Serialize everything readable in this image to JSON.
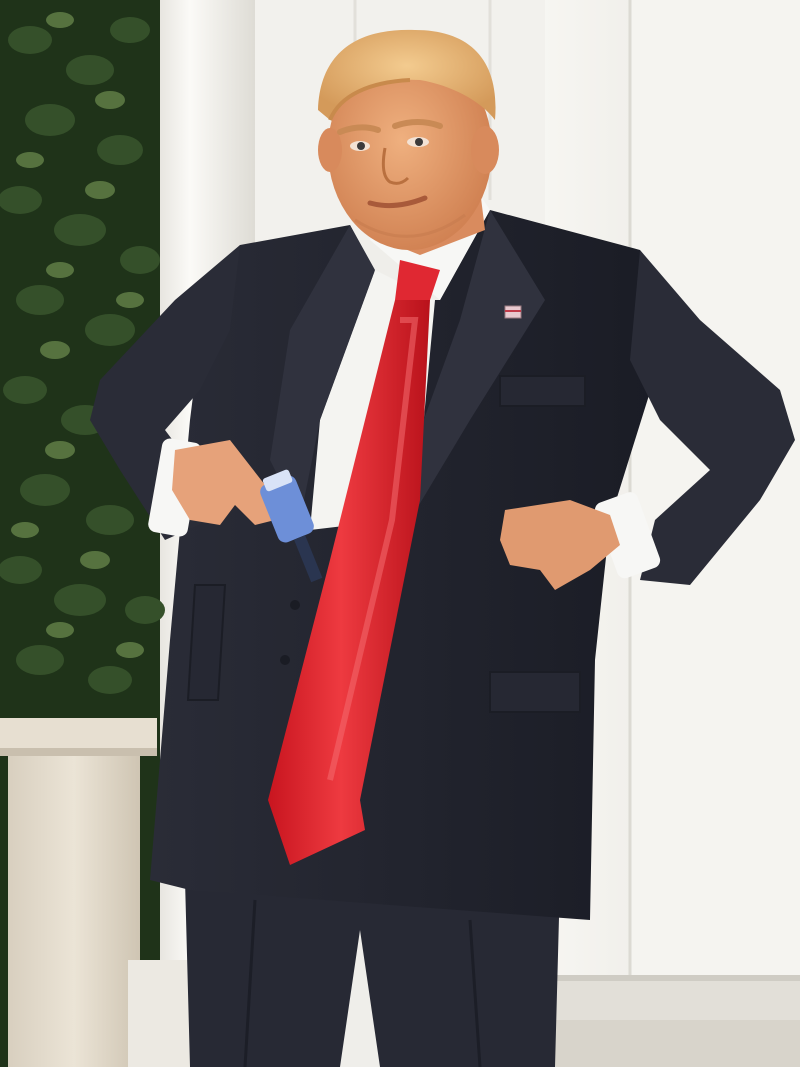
{
  "image": {
    "kind": "photograph",
    "colors": {
      "background_wall": "#efeeea",
      "column": "#f6f5f1",
      "column_shadow": "#dcdad4",
      "foliage_dark": "#1f3319",
      "foliage_mid": "#35502a",
      "foliage_light": "#56723f",
      "stone_planter": "#e4dccd",
      "stone_shadow": "#c9bfae",
      "suit": "#23252f",
      "suit_highlight": "#3a3d4a",
      "shirt": "#f7f7f5",
      "tie": "#d8222c",
      "tie_highlight": "#f04a4f",
      "skin": "#e49a6a",
      "hair": "#e8b272",
      "step": "#e2dfd8",
      "bottle": "#5a7bc8"
    }
  }
}
